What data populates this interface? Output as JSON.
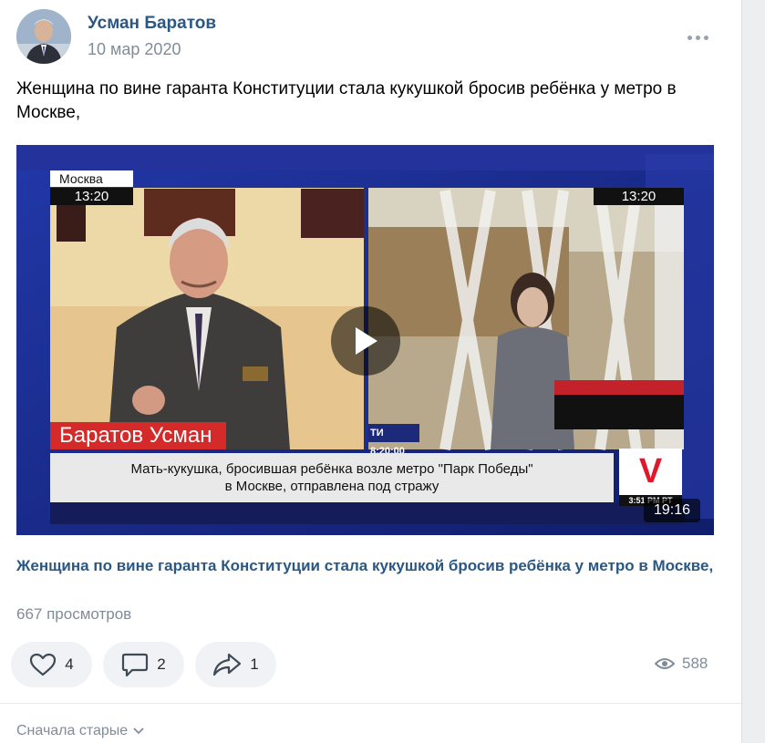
{
  "post": {
    "author": "Усман Баратов",
    "date": "10 мар 2020",
    "text": "Женщина по вине гаранта Конституции стала кукушкой бросив ребёнка у метро в Москве,"
  },
  "video": {
    "overlay": {
      "city": "Москва",
      "time_left": "13:20",
      "time_right": "13:20",
      "name_plate": "Баратов Усман",
      "ticker_tag": "ТИ 8:20:00",
      "caption_line1": "Мать-кукушка, бросившая ребёнка возле метро \"Парк Победы\"",
      "caption_line2": "в Москве, отправлена под стражу",
      "channel_logo": "V",
      "clock": "3:51 PM PT"
    },
    "duration": "19:16",
    "title": "Женщина по вине гаранта Конституции стала кукушкой бросив ребёнка у метро в Москве,",
    "views": "667 просмотров"
  },
  "actions": {
    "likes": "4",
    "comments": "2",
    "shares": "1",
    "views": "588"
  },
  "comments_sort": "Сначала старые",
  "icons": {
    "more": "more-horizontal-icon",
    "play": "play-icon",
    "like": "heart-icon",
    "comment": "comment-icon",
    "share": "share-arrow-icon",
    "views": "eye-icon",
    "sort": "chevron-down-icon"
  },
  "colors": {
    "link": "#2a5885",
    "secondary_text": "#818c99",
    "button_bg": "#f0f2f5",
    "tv_blue": "#1a2f8f",
    "tv_red": "#d42a2a"
  }
}
